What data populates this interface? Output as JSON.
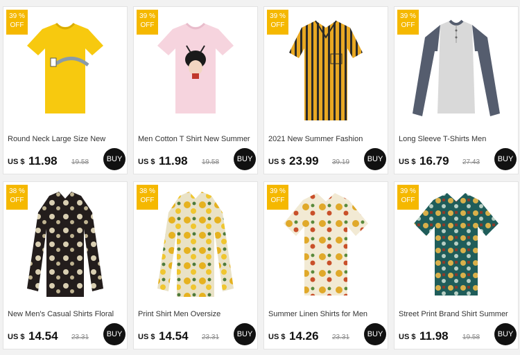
{
  "colors": {
    "badge": "#f5b800",
    "buy_bg": "#111111",
    "background": "#f2f2f2"
  },
  "products": [
    {
      "discount_pct": "39",
      "discount_unit": "%",
      "discount_word": "OFF",
      "title": "Round Neck Large Size New",
      "currency": "US $",
      "price": "11.98",
      "old_price": "19.58",
      "buy_label": "BUY",
      "image": "yellow-tshirt"
    },
    {
      "discount_pct": "39",
      "discount_unit": "%",
      "discount_word": "OFF",
      "title": "Men Cotton T Shirt New Summer",
      "currency": "US $",
      "price": "11.98",
      "old_price": "19.58",
      "buy_label": "BUY",
      "image": "pink-tshirt"
    },
    {
      "discount_pct": "39",
      "discount_unit": "%",
      "discount_word": "OFF",
      "title": "2021 New Summer Fashion",
      "currency": "US $",
      "price": "23.99",
      "old_price": "39.19",
      "buy_label": "BUY",
      "image": "striped-shirt"
    },
    {
      "discount_pct": "39",
      "discount_unit": "%",
      "discount_word": "OFF",
      "title": "Long Sleeve T-Shirts Men",
      "currency": "US $",
      "price": "16.79",
      "old_price": "27.43",
      "buy_label": "BUY",
      "image": "raglan-longsleeve"
    },
    {
      "discount_pct": "38",
      "discount_unit": "%",
      "discount_word": "OFF",
      "title": "New Men's Casual Shirts Floral",
      "currency": "US $",
      "price": "14.54",
      "old_price": "23.31",
      "buy_label": "BUY",
      "image": "black-floral-shirt"
    },
    {
      "discount_pct": "38",
      "discount_unit": "%",
      "discount_word": "OFF",
      "title": "Print Shirt Men Oversize",
      "currency": "US $",
      "price": "14.54",
      "old_price": "23.31",
      "buy_label": "BUY",
      "image": "yellow-floral-shirt"
    },
    {
      "discount_pct": "39",
      "discount_unit": "%",
      "discount_word": "OFF",
      "title": "Summer Linen Shirts for Men",
      "currency": "US $",
      "price": "14.26",
      "old_price": "23.31",
      "buy_label": "BUY",
      "image": "linen-floral-shirt"
    },
    {
      "discount_pct": "39",
      "discount_unit": "%",
      "discount_word": "OFF",
      "title": "Street Print Brand Shirt Summer",
      "currency": "US $",
      "price": "11.98",
      "old_price": "19.58",
      "buy_label": "BUY",
      "image": "teal-print-shirt"
    }
  ]
}
